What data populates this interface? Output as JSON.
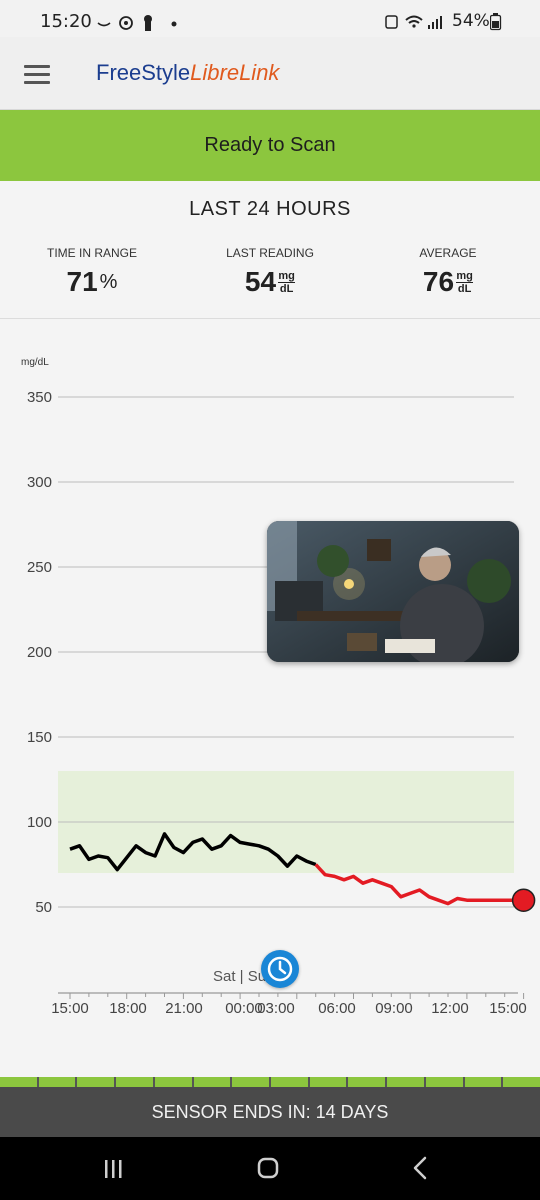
{
  "status_bar": {
    "time": "15:20",
    "left_icons": [
      "notification-icon",
      "heart-target-icon",
      "keyhole-icon",
      "dot-icon"
    ],
    "battery": "54%",
    "right_icons": [
      "lock-icon",
      "wifi-icon",
      "signal-icon",
      "battery-icon"
    ]
  },
  "app_bar": {
    "logo_part1": "FreeStyle",
    "logo_part2": "LibreLink",
    "menu_icon": "hamburger-menu-icon"
  },
  "scan_banner": {
    "label": "Ready to Scan",
    "color": "#8cc63e"
  },
  "summary": {
    "title": "LAST 24 HOURS",
    "time_in_range": {
      "label": "TIME IN RANGE",
      "value": "71",
      "unit": "%"
    },
    "last_reading": {
      "label": "LAST READING",
      "value": "54",
      "unit_top": "mg",
      "unit_bottom": "dL"
    },
    "average": {
      "label": "AVERAGE",
      "value": "76",
      "unit_top": "mg",
      "unit_bottom": "dL"
    }
  },
  "chart_data": {
    "type": "line",
    "ylabel": "mg/dL",
    "ylim": [
      40,
      350
    ],
    "y_ticks": [
      350,
      300,
      250,
      200,
      150,
      100,
      50
    ],
    "x_ticks": [
      "15:00",
      "18:00",
      "21:00",
      "00:00",
      "03:00",
      "06:00",
      "09:00",
      "12:00",
      "15:00"
    ],
    "day_marker": "Sat | Su",
    "target_range": [
      70,
      130
    ],
    "grid": true,
    "colors": {
      "normal": "#000000",
      "low": "#e31b23",
      "range_fill": "#e6f0da"
    },
    "series": [
      {
        "x_hours": [
          0,
          0.5,
          1,
          1.5,
          2,
          2.5,
          3,
          3.5,
          4,
          4.5,
          5,
          5.5,
          6,
          6.5,
          7,
          7.5,
          8,
          8.5,
          9,
          9.5,
          10,
          10.5,
          11,
          11.5,
          12,
          12.5,
          13,
          13.5,
          14,
          14.5,
          15,
          15.5,
          16,
          16.5,
          17,
          17.5,
          18,
          18.5,
          19,
          19.5,
          20,
          20.5,
          21,
          21.5,
          22,
          22.5,
          23,
          23.5,
          24
        ],
        "values": [
          84,
          86,
          78,
          80,
          79,
          72,
          79,
          86,
          82,
          80,
          93,
          85,
          82,
          88,
          90,
          84,
          86,
          92,
          88,
          87,
          86,
          84,
          80,
          74,
          80,
          77,
          75,
          69,
          68,
          66,
          68,
          64,
          66,
          64,
          62,
          56,
          58,
          60,
          56,
          54,
          52,
          55,
          54,
          54,
          54,
          54,
          54,
          54,
          54
        ]
      }
    ],
    "last_point": {
      "hour": 24,
      "value": 54
    }
  },
  "media_overlay": {
    "name": "picture-in-picture-video"
  },
  "clock_button": {
    "icon": "clock-icon"
  },
  "sensor": {
    "label": "SENSOR ENDS IN: 14 DAYS",
    "segments": 14,
    "remaining_days": 14
  },
  "nav_bar": {
    "recents": "recents-icon",
    "home": "home-icon",
    "back": "back-icon"
  }
}
